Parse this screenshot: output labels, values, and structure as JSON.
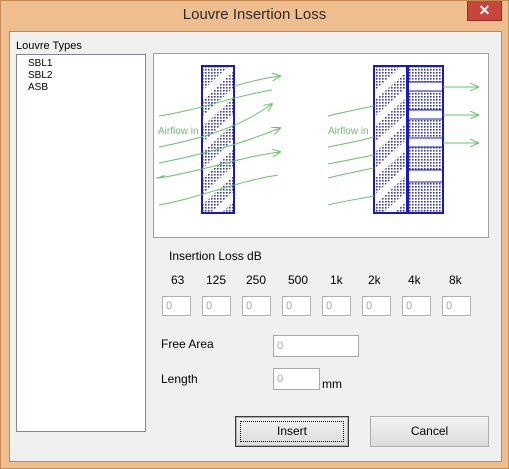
{
  "window": {
    "title": "Louvre Insertion Loss",
    "close_label": "✕"
  },
  "louvre_types": {
    "label": "Louvre Types",
    "items": [
      "SBL1",
      "SBL2",
      "ASB"
    ]
  },
  "diagram": {
    "airflow_label": "Airflow in"
  },
  "insertion_loss": {
    "label": "Insertion Loss dB",
    "bands": [
      {
        "freq": "63",
        "value": "0"
      },
      {
        "freq": "125",
        "value": "0"
      },
      {
        "freq": "250",
        "value": "0"
      },
      {
        "freq": "500",
        "value": "0"
      },
      {
        "freq": "1k",
        "value": "0"
      },
      {
        "freq": "2k",
        "value": "0"
      },
      {
        "freq": "4k",
        "value": "0"
      },
      {
        "freq": "8k",
        "value": "0"
      }
    ]
  },
  "free_area": {
    "label": "Free Area",
    "value": "0"
  },
  "length": {
    "label": "Length",
    "value": "0",
    "unit": "mm"
  },
  "buttons": {
    "insert": "Insert",
    "cancel": "Cancel"
  },
  "colors": {
    "louvre_blue": "#1a1ab8",
    "airflow_green": "#6cc06c",
    "title_bar": "#efbe8f",
    "close_red": "#c7463b"
  }
}
